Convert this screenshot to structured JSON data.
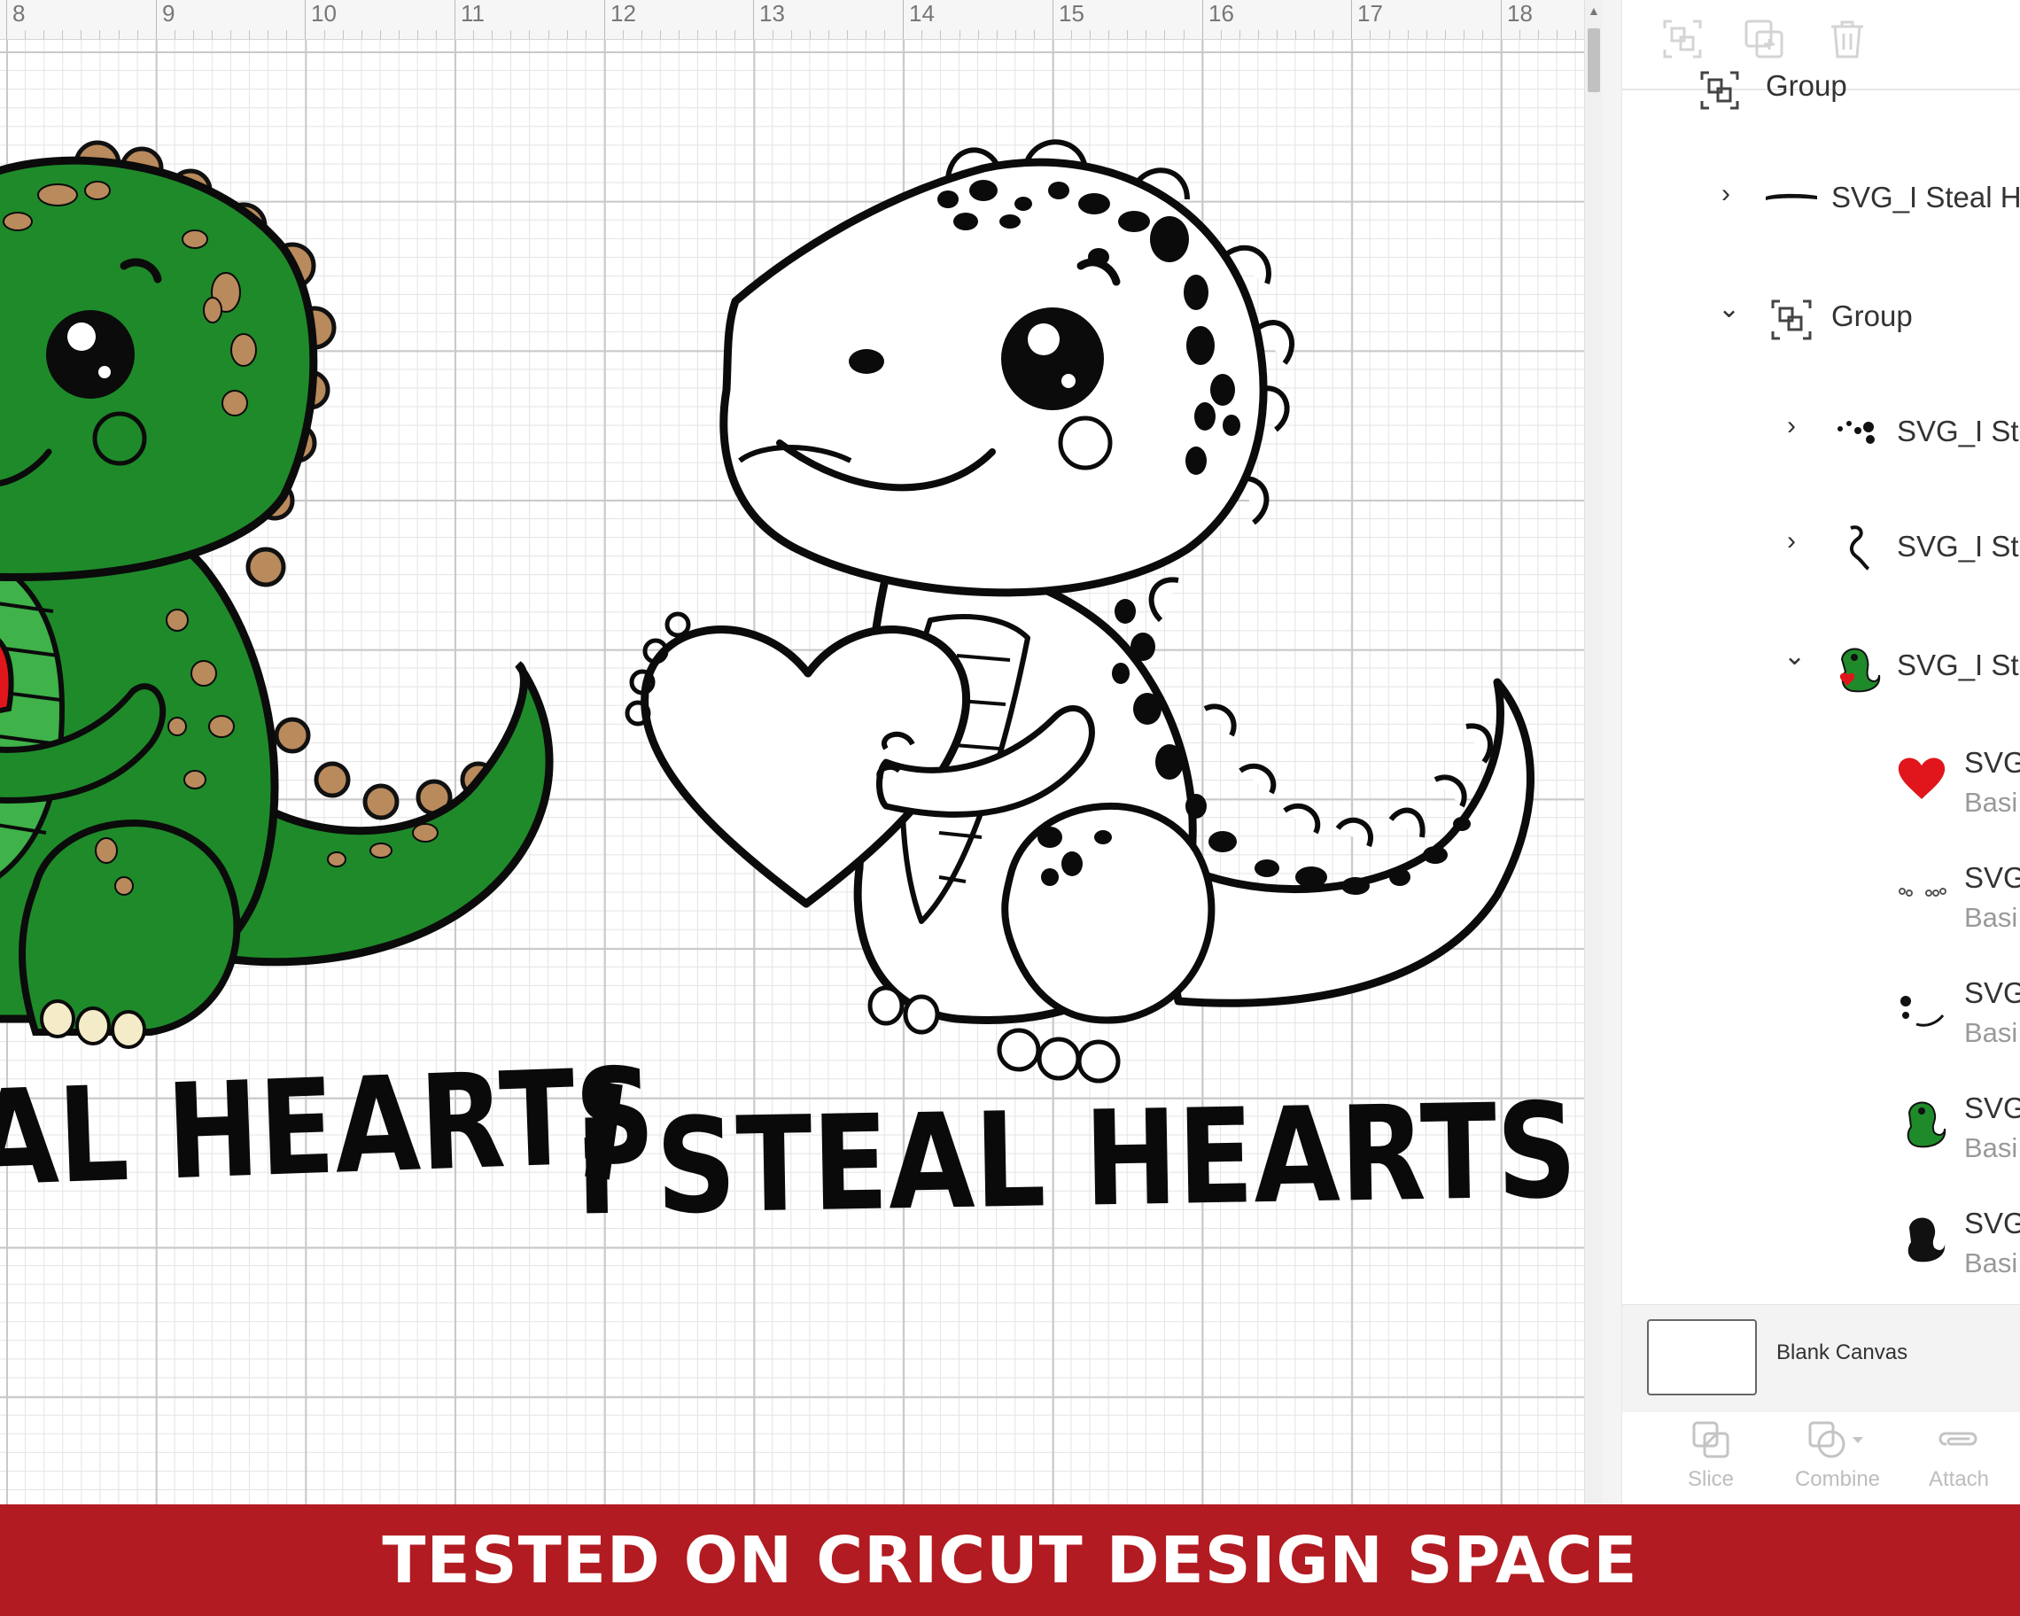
{
  "ruler": {
    "labels": [
      "8",
      "9",
      "10",
      "11",
      "12",
      "13",
      "14",
      "15",
      "16",
      "17",
      "18"
    ]
  },
  "canvas": {
    "left_text": "AL HEARTS",
    "right_text": "I STEAL HEARTS",
    "edge_text": "I"
  },
  "colors": {
    "dino_green": "#1f8a2a",
    "dino_spots": "#b98a5c",
    "heart_red": "#e0161c",
    "banner_red": "#b21b21"
  },
  "layers": {
    "items": [
      {
        "label": "Group",
        "icon": "group-icon"
      },
      {
        "label": "SVG_I Steal He",
        "icon": "text-shape-thumbnail"
      },
      {
        "label": "Group",
        "icon": "group-icon"
      },
      {
        "label": "SVG_I Ste",
        "icon": "spots-thumbnail"
      },
      {
        "label": "SVG_I Ste",
        "icon": "outline-thumbnail"
      },
      {
        "label": "SVG_I Ste",
        "icon": "dino-thumbnail"
      },
      {
        "label": "SVG",
        "sub": "Basi",
        "icon": "heart-thumbnail"
      },
      {
        "label": "SVG",
        "sub": "Basi",
        "icon": "claws-thumbnail"
      },
      {
        "label": "SVG",
        "sub": "Basi",
        "icon": "face-thumbnail"
      },
      {
        "label": "SVG",
        "sub": "Basi",
        "icon": "green-dino-thumbnail"
      },
      {
        "label": "SVG",
        "sub": "Basi",
        "icon": "black-dino-thumbnail"
      }
    ],
    "blank_canvas": "Blank Canvas"
  },
  "tools": {
    "slice": "Slice",
    "combine": "Combine",
    "attach": "Attach"
  },
  "banner": {
    "text": "TESTED ON CRICUT DESIGN SPACE"
  }
}
